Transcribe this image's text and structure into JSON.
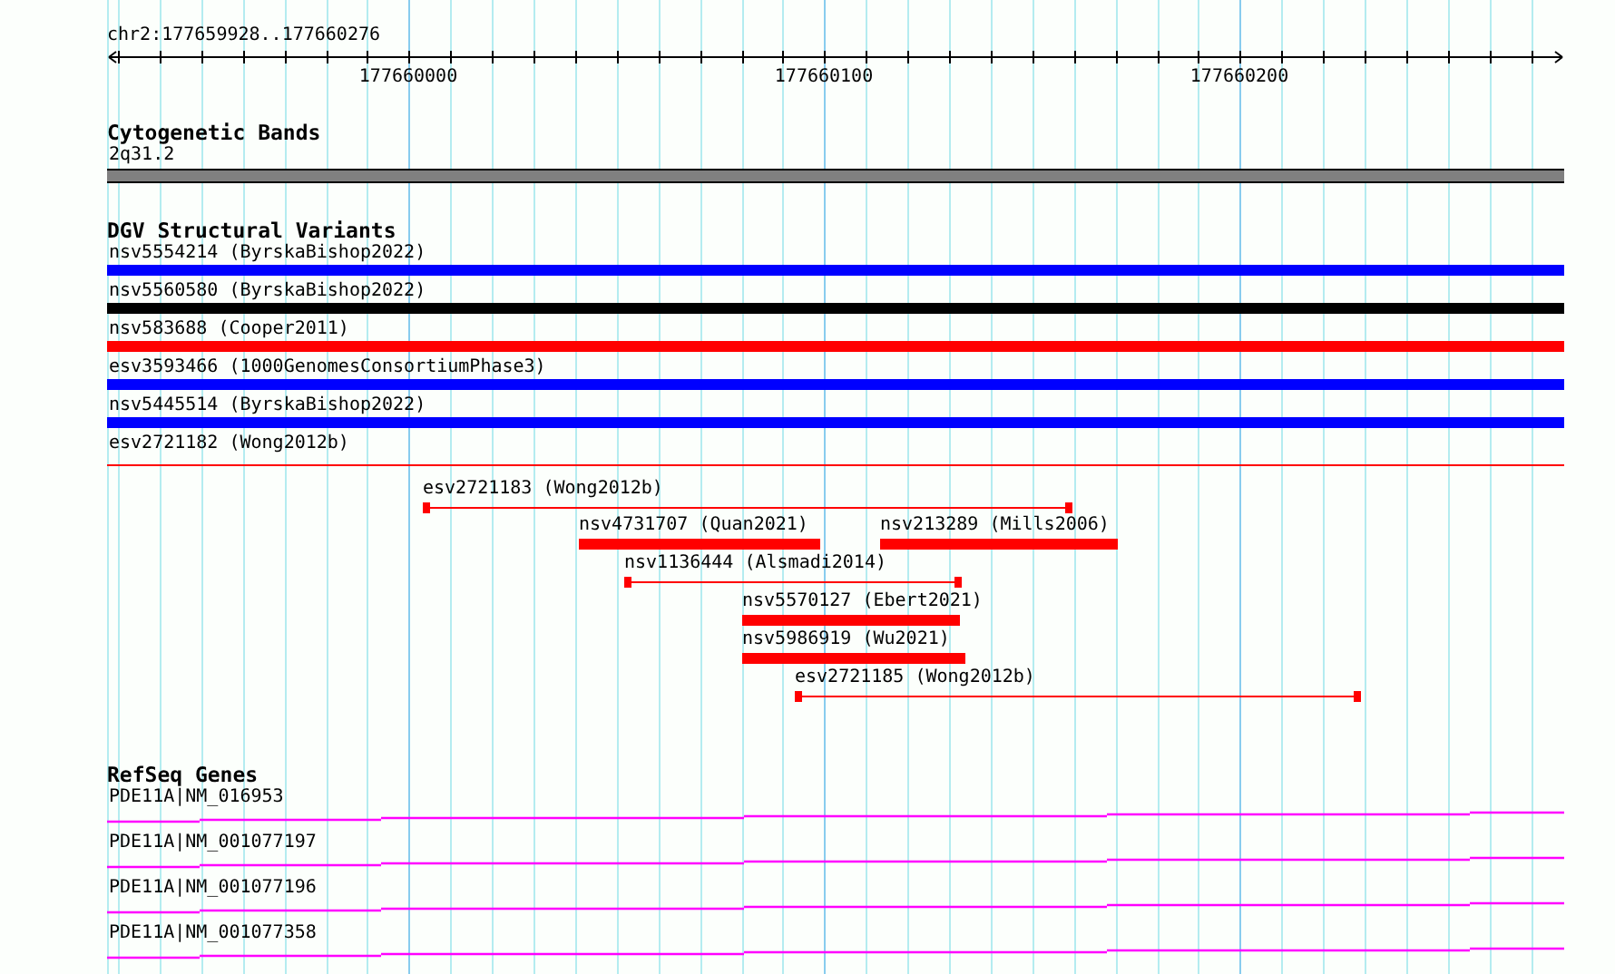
{
  "ruler": {
    "location": "chr2:177659928..177660276",
    "ticks": [
      "177660000",
      "177660100",
      "177660200"
    ]
  },
  "tracks": [
    {
      "title": "Cytogenetic Bands",
      "kind": "bands",
      "features": [
        {
          "label": "2q31.2"
        }
      ]
    },
    {
      "title": "DGV Structural Variants",
      "kind": "variants",
      "features": [
        {
          "label": "nsv5554214 (ByrskaBishop2022)",
          "kind": "bar",
          "color": "#0000ff"
        },
        {
          "label": "nsv5560580 (ByrskaBishop2022)",
          "kind": "bar",
          "color": "#000000"
        },
        {
          "label": "nsv583688 (Cooper2011)",
          "kind": "bar",
          "color": "#ff0000"
        },
        {
          "label": "esv3593466 (1000GenomesConsortiumPhase3)",
          "kind": "bar",
          "color": "#0000ff"
        },
        {
          "label": "nsv5445514 (ByrskaBishop2022)",
          "kind": "bar",
          "color": "#0000ff"
        },
        {
          "label": "esv2721182 (Wong2012b)",
          "kind": "span",
          "color": "#ff0000"
        },
        {
          "label": "esv2721183 (Wong2012b)",
          "kind": "span",
          "color": "#ff0000"
        },
        {
          "label": "nsv4731707 (Quan2021)",
          "kind": "bar",
          "color": "#ff0000"
        },
        {
          "label": "nsv213289 (Mills2006)",
          "kind": "bar",
          "color": "#ff0000"
        },
        {
          "label": "nsv1136444 (Alsmadi2014)",
          "kind": "span",
          "color": "#ff0000"
        },
        {
          "label": "nsv5570127 (Ebert2021)",
          "kind": "bar",
          "color": "#ff0000"
        },
        {
          "label": "nsv5986919 (Wu2021)",
          "kind": "bar",
          "color": "#ff0000"
        },
        {
          "label": "esv2721185 (Wong2012b)",
          "kind": "span",
          "color": "#ff0000"
        }
      ]
    },
    {
      "title": "RefSeq Genes",
      "kind": "genes",
      "features": [
        {
          "label": "PDE11A|NM_016953"
        },
        {
          "label": "PDE11A|NM_001077197"
        },
        {
          "label": "PDE11A|NM_001077196"
        },
        {
          "label": "PDE11A|NM_001077358"
        }
      ]
    }
  ]
}
